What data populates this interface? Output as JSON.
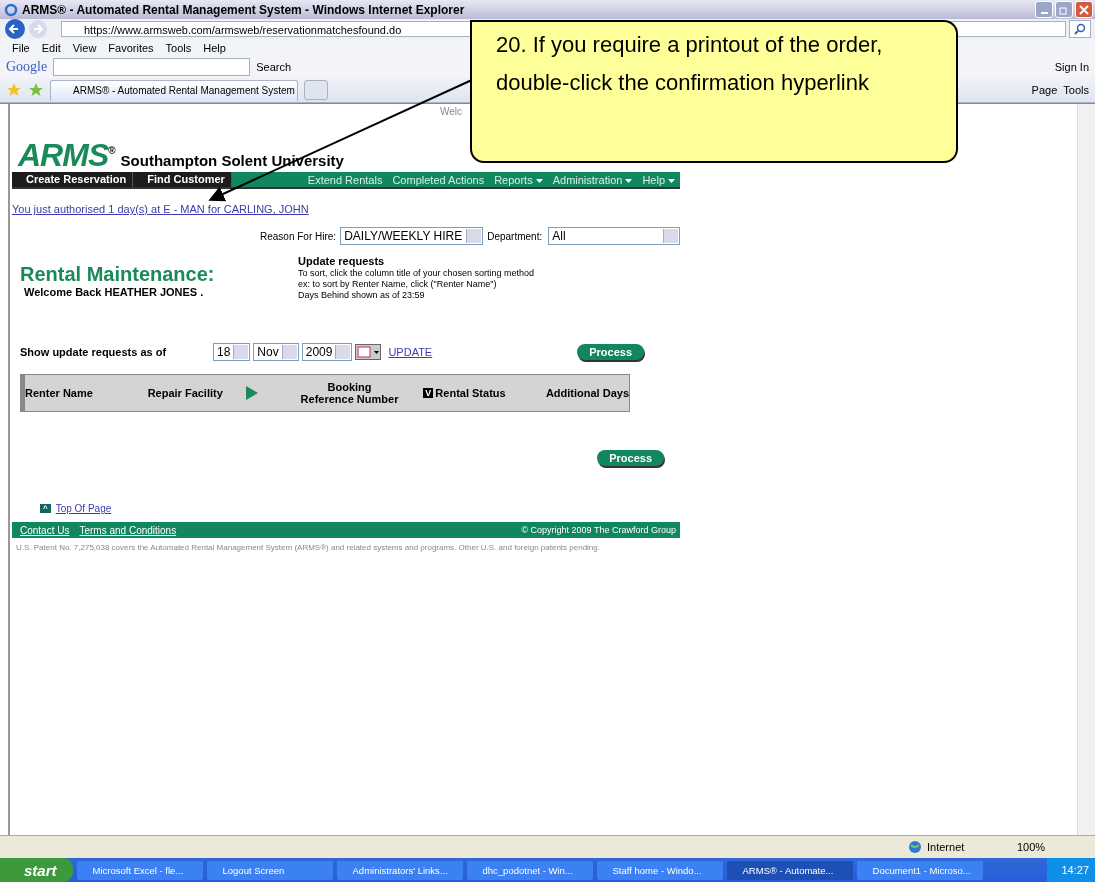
{
  "window": {
    "title": "ARMS® - Automated Rental Management System - Windows Internet Explorer"
  },
  "address_bar": {
    "url": "https://www.armsweb.com/armsweb/reservationmatchesfound.do"
  },
  "menu": [
    "File",
    "Edit",
    "View",
    "Favorites",
    "Tools",
    "Help"
  ],
  "google_toolbar": {
    "logo": "Google",
    "search_label": "Search",
    "sign_in": "Sign In"
  },
  "tabs": [
    {
      "label": "ARMS® - Automated Rental Management System",
      "selected": true
    }
  ],
  "command_bar": [
    "Page",
    "Tools"
  ],
  "page": {
    "logo": "ARMS",
    "logo_mark": "®",
    "university": "Southampton Solent University",
    "welcome_cut": "Welc",
    "nav_left": [
      "Create Reservation",
      "Find Customer"
    ],
    "nav_right": [
      {
        "label": "Extend Rentals",
        "dropdown": false
      },
      {
        "label": "Completed Actions",
        "dropdown": false
      },
      {
        "label": "Reports",
        "dropdown": true
      },
      {
        "label": "Administration",
        "dropdown": true
      },
      {
        "label": "Help",
        "dropdown": true
      }
    ],
    "confirmation_link": "You just authorised 1 day(s) at E - MAN for CARLING, JOHN",
    "reason_label": "Reason For Hire:",
    "reason_value": "DAILY/WEEKLY HIRE",
    "department_label": "Department:",
    "department_value": "All",
    "heading": "Rental Maintenance:",
    "welcome": "Welcome Back HEATHER JONES .",
    "info_title": "Update requests",
    "info_lines": [
      "To sort, click the column title of your chosen sorting method",
      "ex: to sort by Renter Name, click (\"Renter Name\")",
      "Days Behind shown as of 23:59"
    ],
    "show_label": "Show update requests as of",
    "day": "18",
    "month": "Nov",
    "year": "2009",
    "update_link": "UPDATE",
    "process_buttons": [
      "Process",
      "Process"
    ],
    "columns": [
      {
        "label": "Renter Name",
        "kind": "plain"
      },
      {
        "label": "Repair Facility",
        "kind": "plain"
      },
      {
        "kind": "arrow"
      },
      {
        "label": "Booking\nReference Number",
        "kind": "plain"
      },
      {
        "label": "Rental Status",
        "kind": "sorted"
      },
      {
        "label": "Additional Days",
        "kind": "plain"
      }
    ],
    "top_link": "Top Of Page",
    "top_mark": "^",
    "footer_links": [
      "Contact Us",
      "Terms and Conditions"
    ],
    "copyright": "© Copyright  2009  The Crawford Group",
    "patent": "U.S. Patent No. 7,275,038 covers the Automated Rental Management System (ARMS®) and related systems and programs. Other U.S. and foreign patents pending.",
    "sort_mark": "V"
  },
  "status_bar": {
    "zone": "Internet",
    "zoom": "100%"
  },
  "taskbar": {
    "start": "start",
    "time": "14:27",
    "tasks": [
      {
        "label": "Microsoft Excel - fle...",
        "selected": false
      },
      {
        "label": "Logout Screen",
        "selected": false
      },
      {
        "label": "Administrators' Links...",
        "selected": false
      },
      {
        "label": "dhc_podotnet - Win...",
        "selected": false
      },
      {
        "label": "Staff home - Windo...",
        "selected": false
      },
      {
        "label": "ARMS® - Automate...",
        "selected": true
      },
      {
        "label": "Document1 - Microso...",
        "selected": false
      }
    ]
  },
  "callout": {
    "text": "20. If you require a printout of the order, double-click the confirmation hyperlink"
  }
}
